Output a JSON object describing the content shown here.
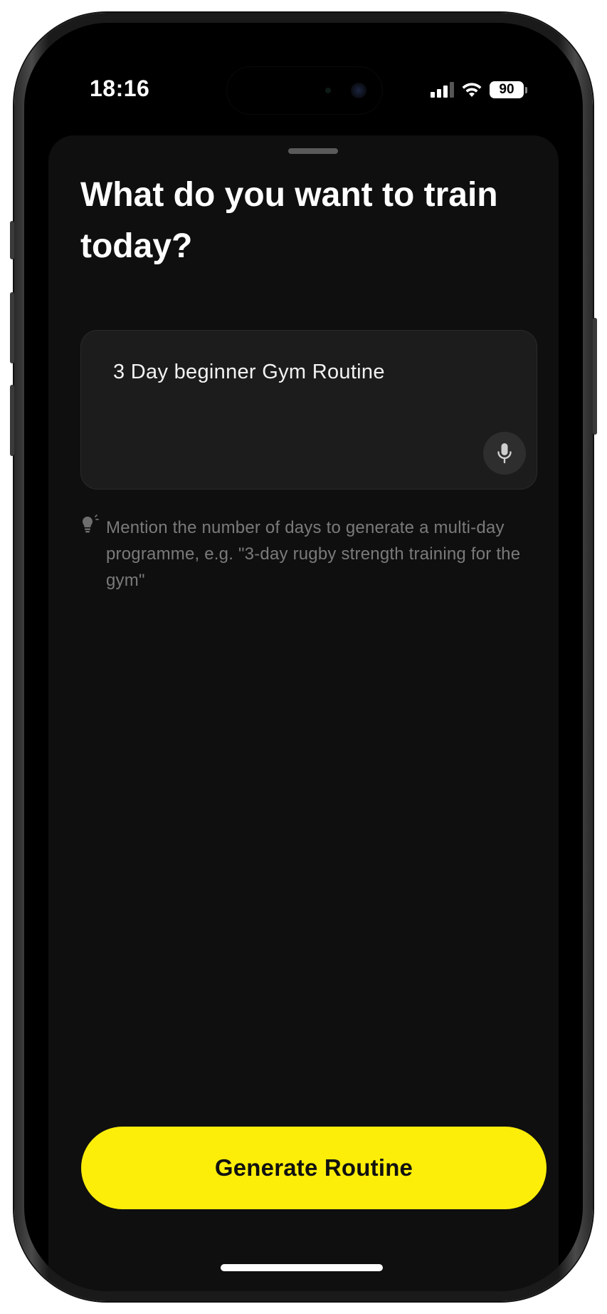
{
  "status_bar": {
    "time": "18:16",
    "battery_level": "90",
    "cellular_bars_active": 3,
    "cellular_bars_total": 4,
    "icons": [
      "cellular-signal-icon",
      "wifi-icon",
      "battery-icon"
    ]
  },
  "sheet": {
    "title": "What do you want to train today?",
    "prompt": {
      "value": "3 Day beginner Gym Routine",
      "mic_icon": "microphone-icon"
    },
    "hint": {
      "icon": "lightbulb-icon",
      "text": "Mention the number of days to generate a multi-day programme, e.g. \"3-day rugby strength training for the gym\""
    },
    "cta_label": "Generate Routine"
  },
  "colors": {
    "accent": "#fcee09",
    "background": "#000000",
    "sheet_background": "#0f0f0f",
    "input_background": "#1c1c1c",
    "hint_text": "#7a7a7a"
  }
}
